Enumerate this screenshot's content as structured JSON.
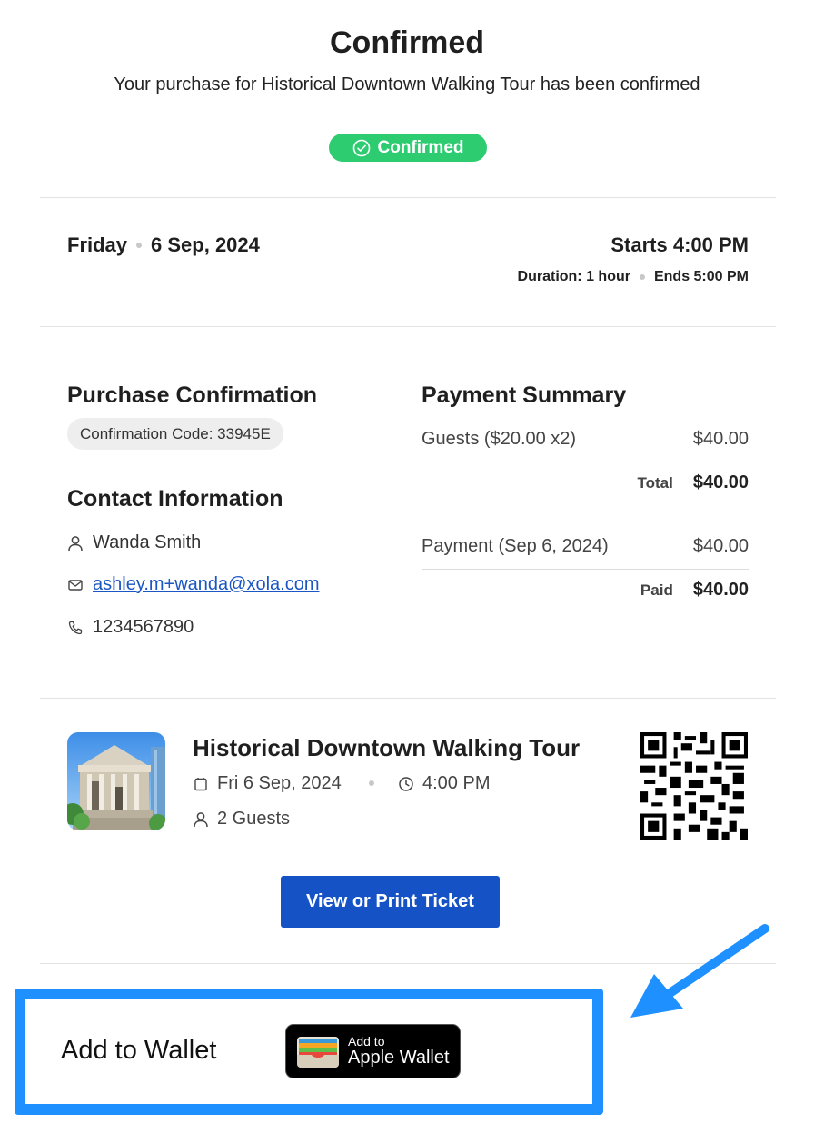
{
  "header": {
    "title": "Confirmed",
    "subtitle": "Your purchase for Historical Downtown Walking Tour has been confirmed",
    "status_badge": "Confirmed",
    "status_color": "#2ecc71"
  },
  "schedule": {
    "day": "Friday",
    "date": "6 Sep, 2024",
    "starts": "Starts 4:00 PM",
    "duration": "Duration: 1 hour",
    "ends": "Ends 5:00 PM"
  },
  "purchase": {
    "heading": "Purchase Confirmation",
    "confirmation_code": "Confirmation Code: 33945E"
  },
  "contact": {
    "heading": "Contact Information",
    "name": "Wanda Smith",
    "email": "ashley.m+wanda@xola.com",
    "phone": "1234567890"
  },
  "payment": {
    "heading": "Payment Summary",
    "guests_label": "Guests ($20.00 x2)",
    "guests_amount": "$40.00",
    "total_label": "Total",
    "total_amount": "$40.00",
    "payment_label": "Payment (Sep 6, 2024)",
    "payment_amount": "$40.00",
    "paid_label": "Paid",
    "paid_amount": "$40.00"
  },
  "tour": {
    "title": "Historical Downtown Walking Tour",
    "date": "Fri 6 Sep, 2024",
    "time": "4:00 PM",
    "guests": "2 Guests",
    "print_button": "View or Print Ticket",
    "button_color": "#1552c6"
  },
  "wallet": {
    "label": "Add to Wallet",
    "button_small": "Add to",
    "button_big": "Apple Wallet",
    "highlight_color": "#1e90ff"
  },
  "icons": [
    "check-circle-icon",
    "person-icon",
    "mail-icon",
    "phone-icon",
    "calendar-icon",
    "clock-icon",
    "qr-code-icon",
    "wallet-icon",
    "arrow-icon"
  ]
}
